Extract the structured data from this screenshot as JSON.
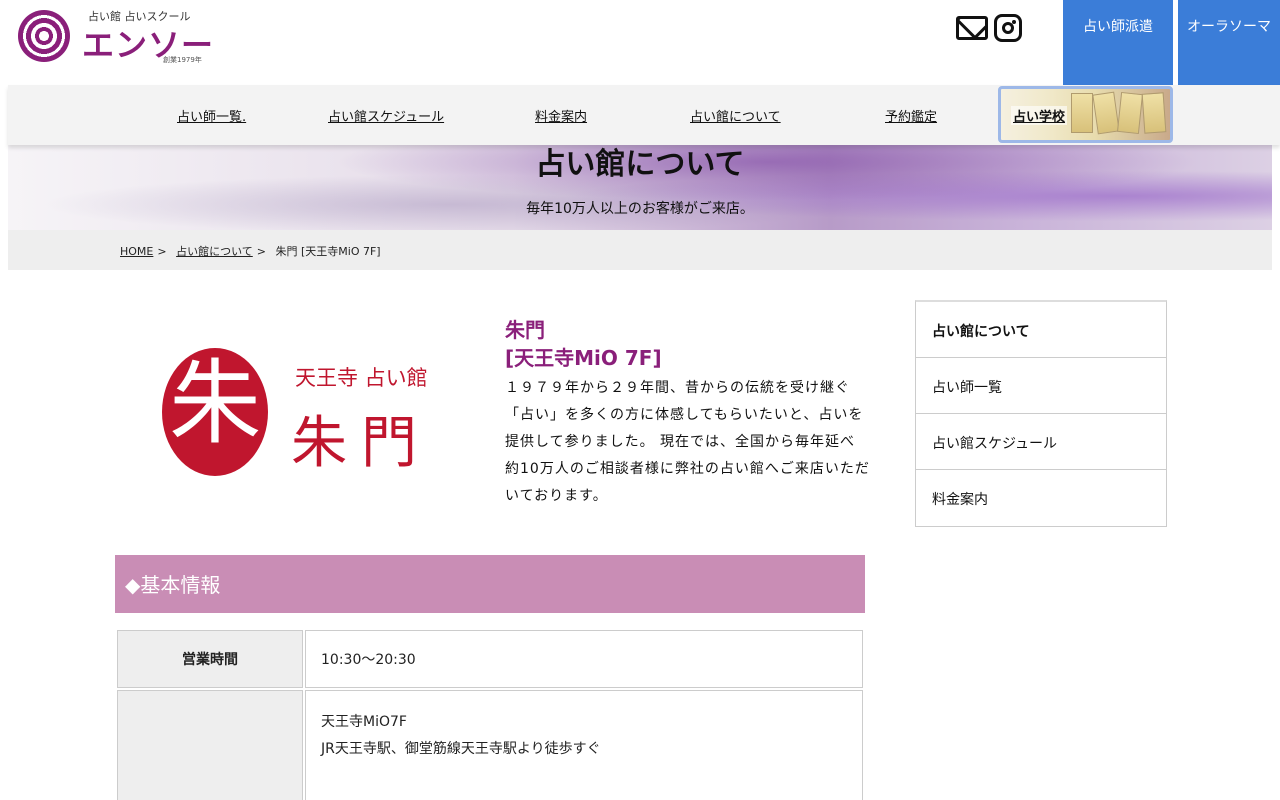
{
  "header": {
    "logo_sub": "占い館 占いスクール",
    "logo_main": "エンソー",
    "logo_est": "創業1979年",
    "dispatch_label": "占い師派遣",
    "aura_label": "オーラソーマ"
  },
  "nav": {
    "items": [
      "占い師一覧.",
      "占い館スケジュール",
      "料金案内",
      "占い館について",
      "予約鑑定"
    ],
    "school_label": "占い学校"
  },
  "hero": {
    "title": "占い館について",
    "subtitle": "毎年10万人以上のお客様がご来店。"
  },
  "breadcrumb": {
    "home": "HOME",
    "parent": "占い館について",
    "current": "朱門 [天王寺MiO 7F]",
    "separator": ">"
  },
  "shop_logo": {
    "circle_char": "朱",
    "sub": "天王寺 占い館",
    "name": "朱門"
  },
  "info": {
    "name_line1": "朱門",
    "name_line2": "[天王寺MiO 7F]",
    "description": "１９７９年から２９年間、昔からの伝統を受け継ぐ「占い」を多くの方に体感してもらいたいと、占いを提供して参りました。 現在では、全国から毎年延べ約10万人のご相談者様に弊社の占い館へご来店いただいております。"
  },
  "section": {
    "title": "◆基本情報"
  },
  "table": {
    "hours_label": "営業時間",
    "hours_value": "10:30〜20:30",
    "access_line1": "天王寺MiO7F",
    "access_line2": "JR天王寺駅、御堂筋線天王寺駅より徒歩すぐ"
  },
  "sidebar": {
    "items": [
      "占い館について",
      "占い師一覧",
      "占い館スケジュール",
      "料金案内"
    ]
  },
  "colors": {
    "brand_purple": "#8a1f7a",
    "button_blue": "#3b7dd8",
    "section_pink": "#c98db5",
    "shumon_red": "#c0162e"
  }
}
